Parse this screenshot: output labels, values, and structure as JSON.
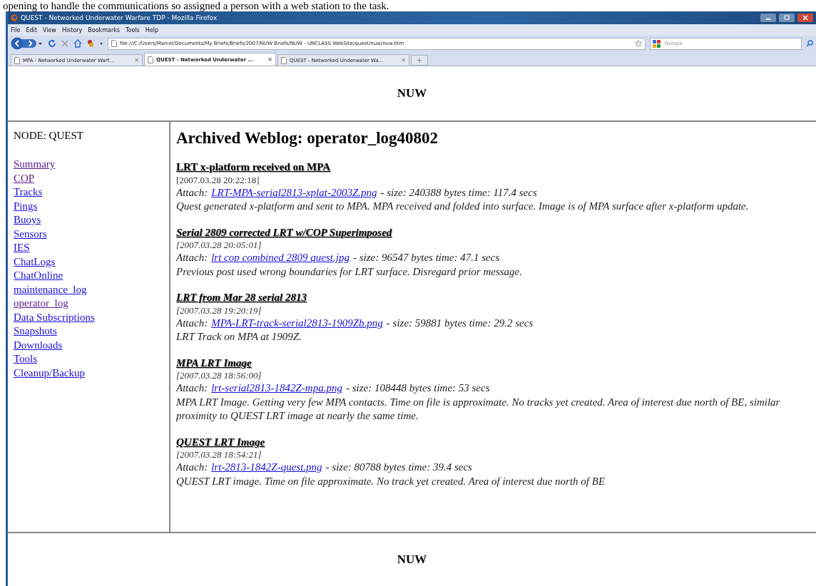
{
  "document_text": "opening to handle the communications so assigned a person with a web station to the task.",
  "window": {
    "title": "QUEST - Networked Underwater Warfare TDP - Mozilla Firefox"
  },
  "menu": [
    "File",
    "Edit",
    "View",
    "History",
    "Bookmarks",
    "Tools",
    "Help"
  ],
  "address": {
    "value": "file:///C:/Users/Marcel/Documents/My Briefs/Briefs/2007/NUW Briefs/NUW - UNCLASS WebSite/quest/nuw/nuw.htm"
  },
  "search": {
    "placeholder": "Google"
  },
  "tabs": [
    {
      "label": "MPA - Networked Underwater Warf...",
      "close": "×",
      "selected": false
    },
    {
      "label": "QUEST - Networked Underwater ...",
      "close": "×",
      "selected": true
    },
    {
      "label": "QUEST - Networked Underwater Wa...",
      "close": "×",
      "selected": false
    }
  ],
  "page": {
    "header": "NUW",
    "footer": "NUW",
    "sidebar": {
      "node": "NODE: QUEST",
      "links": [
        {
          "label": "Summary",
          "visited": true
        },
        {
          "label": "COP",
          "visited": true
        },
        {
          "label": "Tracks",
          "visited": false
        },
        {
          "label": "Pings",
          "visited": false
        },
        {
          "label": "Buoys",
          "visited": false
        },
        {
          "label": "Sensors",
          "visited": false
        },
        {
          "label": "IES",
          "visited": false
        },
        {
          "label": "ChatLogs",
          "visited": false
        },
        {
          "label": "ChatOnline",
          "visited": false
        },
        {
          "label": "maintenance_log",
          "visited": false
        },
        {
          "label": "operator_log",
          "visited": true
        },
        {
          "label": "Data Subscriptions",
          "visited": false
        },
        {
          "label": "Snapshots",
          "visited": false
        },
        {
          "label": "Downloads",
          "visited": false
        },
        {
          "label": "Tools",
          "visited": false
        },
        {
          "label": "Cleanup/Backup",
          "visited": false
        }
      ]
    },
    "heading": "Archived Weblog: operator_log40802",
    "posts": [
      {
        "title": "LRT x-platform received on MPA",
        "italic": false,
        "date": "[2007.03.28 20:22:18]",
        "attach_label": "Attach:",
        "file": "LRT-MPA-serial2813-xplat-2003Z.png",
        "details": "- size: 240388 bytes time: 117.4 secs",
        "body": "Quest generated x-platform and sent to MPA. MPA received and folded into surface. Image is of MPA surface after x-platform update."
      },
      {
        "title": "Serial 2809 corrected LRT w/COP Superimposed",
        "italic": true,
        "date": "[2007.03.28 20:05:01]",
        "attach_label": "Attach:",
        "file": "lrt cop combined 2809 quest.jpg",
        "details": "- size: 96547 bytes time: 47.1 secs",
        "body": "Previous post used wrong boundaries for LRT surface. Disregard prior message."
      },
      {
        "title": "LRT from Mar 28 serial 2813",
        "italic": true,
        "date": "[2007.03.28 19:20:19]",
        "attach_label": "Attach:",
        "file": "MPA-LRT-track-serial2813-1909Zb.png",
        "details": "- size: 59881 bytes time: 29.2 secs",
        "body": "LRT Track on MPA at 1909Z."
      },
      {
        "title": "MPA LRT Image",
        "italic": true,
        "date": "[2007.03.28 18:56:00]",
        "attach_label": "Attach:",
        "file": "lrt-serial2813-1842Z-mpa.png",
        "details": "- size: 108448 bytes time: 53 secs",
        "body": "MPA LRT Image. Getting very few MPA contacts. Time on file is approximate. No tracks yet created. Area of interest due north of BE, similar proximity to QUEST LRT image at nearly the same time."
      },
      {
        "title": "QUEST LRT Image",
        "italic": true,
        "date": "[2007.03.28 18:54:21]",
        "attach_label": "Attach:",
        "file": "lrt-2813-1842Z-quest.png",
        "details": "- size: 80788 bytes time: 39.4 secs",
        "body": "QUEST LRT image. Time on file approximate. No track yet created. Area of interest due north of BE"
      }
    ]
  }
}
